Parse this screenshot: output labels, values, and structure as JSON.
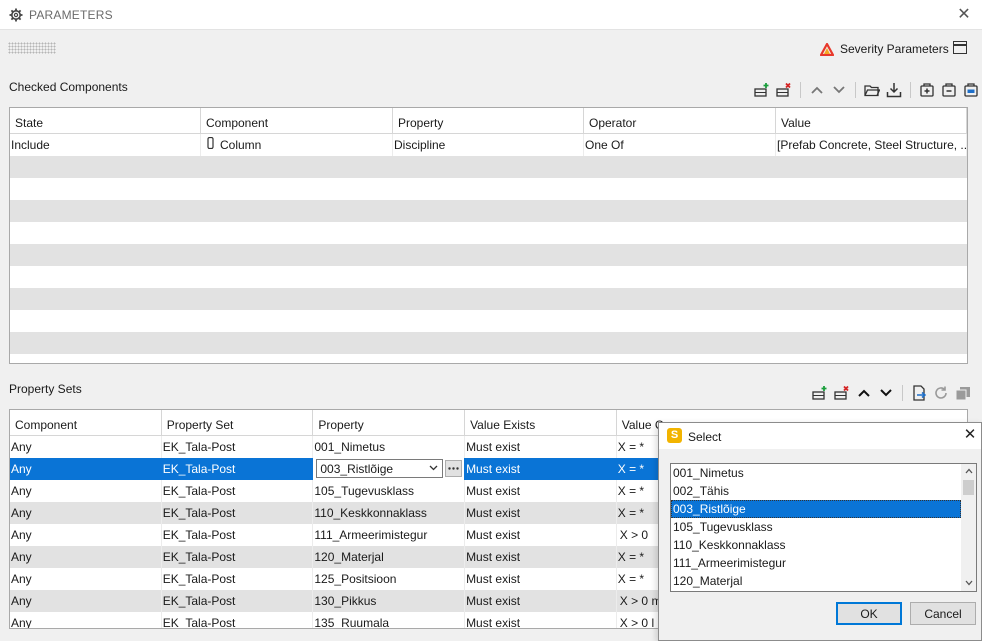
{
  "window": {
    "title": "PARAMETERS",
    "severity_label": "Severity Parameters"
  },
  "checked_components": {
    "title": "Checked Components",
    "toolbar_icons": [
      "add-row-icon",
      "delete-row-icon",
      "move-up-icon",
      "move-down-icon",
      "open-folder-icon",
      "download-icon",
      "add-group-icon",
      "remove-group-icon",
      "edit-group-icon"
    ],
    "columns": [
      "State",
      "Component",
      "Property",
      "Operator",
      "Value"
    ],
    "rows": [
      {
        "state": "Include",
        "component": "Column",
        "property": "Discipline",
        "operator": "One Of",
        "value": "[Prefab Concrete, Steel Structure, ..."
      }
    ]
  },
  "property_sets": {
    "title": "Property Sets",
    "toolbar_icons": [
      "add-row-icon",
      "delete-row-icon",
      "move-up-icon",
      "move-down-icon",
      "export-icon",
      "refresh-icon",
      "copy-icon"
    ],
    "columns": [
      "Component",
      "Property Set",
      "Property",
      "Value Exists",
      "Value C"
    ],
    "rows": [
      {
        "component": "Any",
        "set": "EK_Tala-Post",
        "property": "001_Nimetus",
        "exists": "Must exist",
        "cond": "X = *"
      },
      {
        "component": "Any",
        "set": "EK_Tala-Post",
        "property": "003_Ristlõige",
        "exists": "Must exist",
        "cond": "X = *"
      },
      {
        "component": "Any",
        "set": "EK_Tala-Post",
        "property": "105_Tugevusklass",
        "exists": "Must exist",
        "cond": "X = *"
      },
      {
        "component": "Any",
        "set": "EK_Tala-Post",
        "property": "110_Keskkonnaklass",
        "exists": "Must exist",
        "cond": "X = *"
      },
      {
        "component": "Any",
        "set": "EK_Tala-Post",
        "property": "111_Armeerimistegur",
        "exists": "Must exist",
        "cond": "X > 0"
      },
      {
        "component": "Any",
        "set": "EK_Tala-Post",
        "property": "120_Materjal",
        "exists": "Must exist",
        "cond": "X = *"
      },
      {
        "component": "Any",
        "set": "EK_Tala-Post",
        "property": "125_Positsioon",
        "exists": "Must exist",
        "cond": "X = *"
      },
      {
        "component": "Any",
        "set": "EK_Tala-Post",
        "property": "130_Pikkus",
        "exists": "Must exist",
        "cond": "X > 0 m"
      },
      {
        "component": "Any",
        "set": "EK_Tala-Post",
        "property": "135_Ruumala",
        "exists": "Must exist",
        "cond": "X > 0 l"
      }
    ],
    "editing_value": "003_Ristlõige"
  },
  "select_dialog": {
    "title": "Select",
    "items": [
      "001_Nimetus",
      "002_Tähis",
      "003_Ristlõige",
      "105_Tugevusklass",
      "110_Keskkonnaklass",
      "111_Armeerimistegur",
      "120_Materjal"
    ],
    "selected_index": 2,
    "ok_label": "OK",
    "cancel_label": "Cancel"
  },
  "colors": {
    "selection": "#0a74d6",
    "stripe": "#e2e2e2",
    "severity_icon": "#e8382b",
    "select_badge": "#f2b400",
    "add_icon": "#1a9e3c",
    "delete_icon": "#d42323"
  }
}
